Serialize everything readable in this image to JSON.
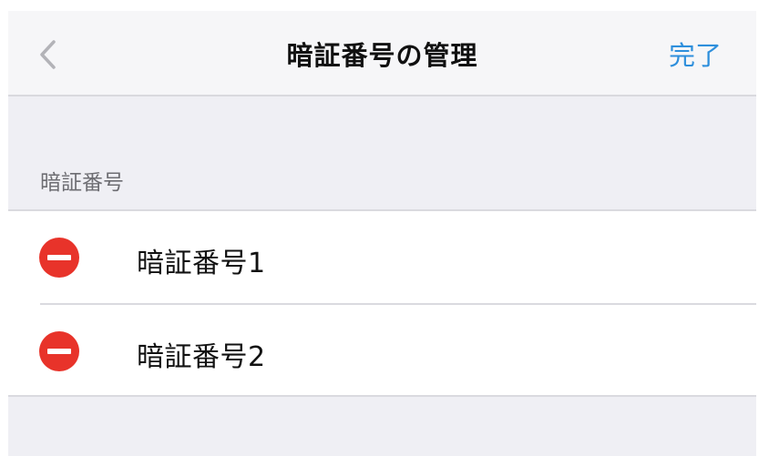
{
  "navbar": {
    "title": "暗証番号の管理",
    "done_label": "完了",
    "back_icon": "chevron-left-icon"
  },
  "section": {
    "header": "暗証番号"
  },
  "items": [
    {
      "label": "暗証番号1",
      "action_icon": "delete-minus-icon"
    },
    {
      "label": "暗証番号2",
      "action_icon": "delete-minus-icon"
    }
  ],
  "colors": {
    "accent": "#2e8fdc",
    "delete": "#e8332a",
    "background": "#efeff4",
    "navbar": "#f6f6f8"
  }
}
